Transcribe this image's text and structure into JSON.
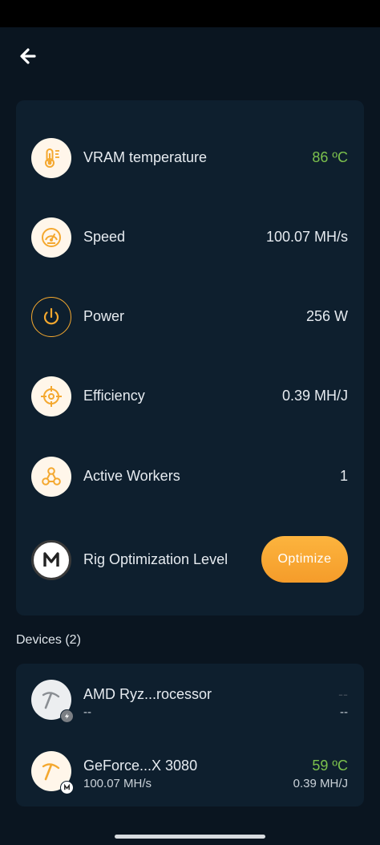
{
  "header": {
    "back_icon": "arrow-left-icon"
  },
  "stats": [
    {
      "icon": "thermometer-icon",
      "label": "VRAM temperature",
      "value": "86 ºC",
      "value_color": "#7cc14d"
    },
    {
      "icon": "speedometer-icon",
      "label": "Speed",
      "value": "100.07 MH/s"
    },
    {
      "icon": "power-icon",
      "label": "Power",
      "value": "256 W"
    },
    {
      "icon": "crosshair-icon",
      "label": "Efficiency",
      "value": "0.39 MH/J"
    },
    {
      "icon": "workers-network-icon",
      "label": "Active Workers",
      "value": "1"
    },
    {
      "icon": "brand-m-icon",
      "label": "Rig Optimization Level",
      "button": "Optimize"
    }
  ],
  "devices": {
    "title": "Devices (2)",
    "items": [
      {
        "icon": "pickaxe-icon",
        "badge": "lightning-badge-icon",
        "name": "AMD Ryz...rocessor",
        "sub": "--",
        "right_top": "--",
        "right_bottom": "--"
      },
      {
        "icon": "pickaxe-icon",
        "badge": "brand-m-badge-icon",
        "name": "GeForce...X 3080",
        "sub": "100.07 MH/s",
        "right_top": "59 ºC",
        "right_bottom": "0.39 MH/J"
      }
    ]
  },
  "colors": {
    "accent": "#f4a82f",
    "good": "#7cc14d",
    "background": "#0a1520",
    "card": "#0e1f2e"
  }
}
